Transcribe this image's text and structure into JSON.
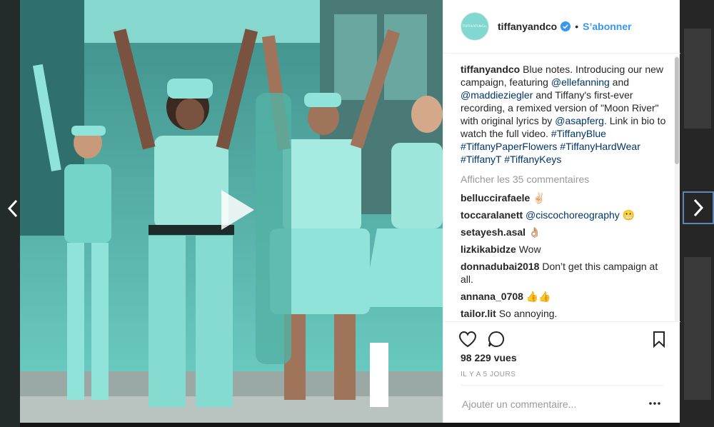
{
  "colors": {
    "brand": "#81d8d0",
    "link": "#003569",
    "follow": "#3897f0",
    "verified": "#3897f0"
  },
  "post": {
    "header": {
      "username": "tiffanyandco",
      "separator": "•",
      "follow_label": "S’abonner",
      "avatar_icon": "tiffany-logo-icon"
    },
    "caption": {
      "username": "tiffanyandco",
      "text_1": " Blue notes. Introducing our new campaign, featuring ",
      "mention_1": "@ellefanning",
      "text_2": " and ",
      "mention_2": "@maddieziegler",
      "text_3": " and Tiffany's first-ever recording, a remixed version of \"Moon River\" with original lyrics by ",
      "mention_3": "@asapferg",
      "text_4": ". Link in bio to watch the full video. ",
      "hashtags": [
        "#TiffanyBlue",
        "#TiffanyPaperFlowers",
        "#TiffanyHardWear",
        "#TiffanyT",
        "#TiffanyKeys"
      ]
    },
    "view_all_comments": "Afficher les 35 commentaires",
    "comments": [
      {
        "user": "belluccirafaele",
        "text": "✌🏻"
      },
      {
        "user": "toccaralanett",
        "mention": "@ciscochoreography",
        "text": "😬"
      },
      {
        "user": "setayesh.asal",
        "text": "👌🏼"
      },
      {
        "user": "lizkikabidze",
        "text": "Wow"
      },
      {
        "user": "donnadubai2018",
        "text": "Don’t get this campaign at all."
      },
      {
        "user": "annana_0708",
        "text": "👍👍"
      },
      {
        "user": "tailor.lit",
        "text": "So annoying."
      }
    ],
    "views": "98 229 vues",
    "time_ago": "IL Y A 5 JOURS",
    "comment_placeholder": "Ajouter un commentaire...",
    "icons": [
      "heart-icon",
      "comment-icon",
      "bookmark-icon",
      "more-icon",
      "play-icon",
      "chevron-left-icon",
      "chevron-right-icon",
      "verified-icon"
    ]
  }
}
